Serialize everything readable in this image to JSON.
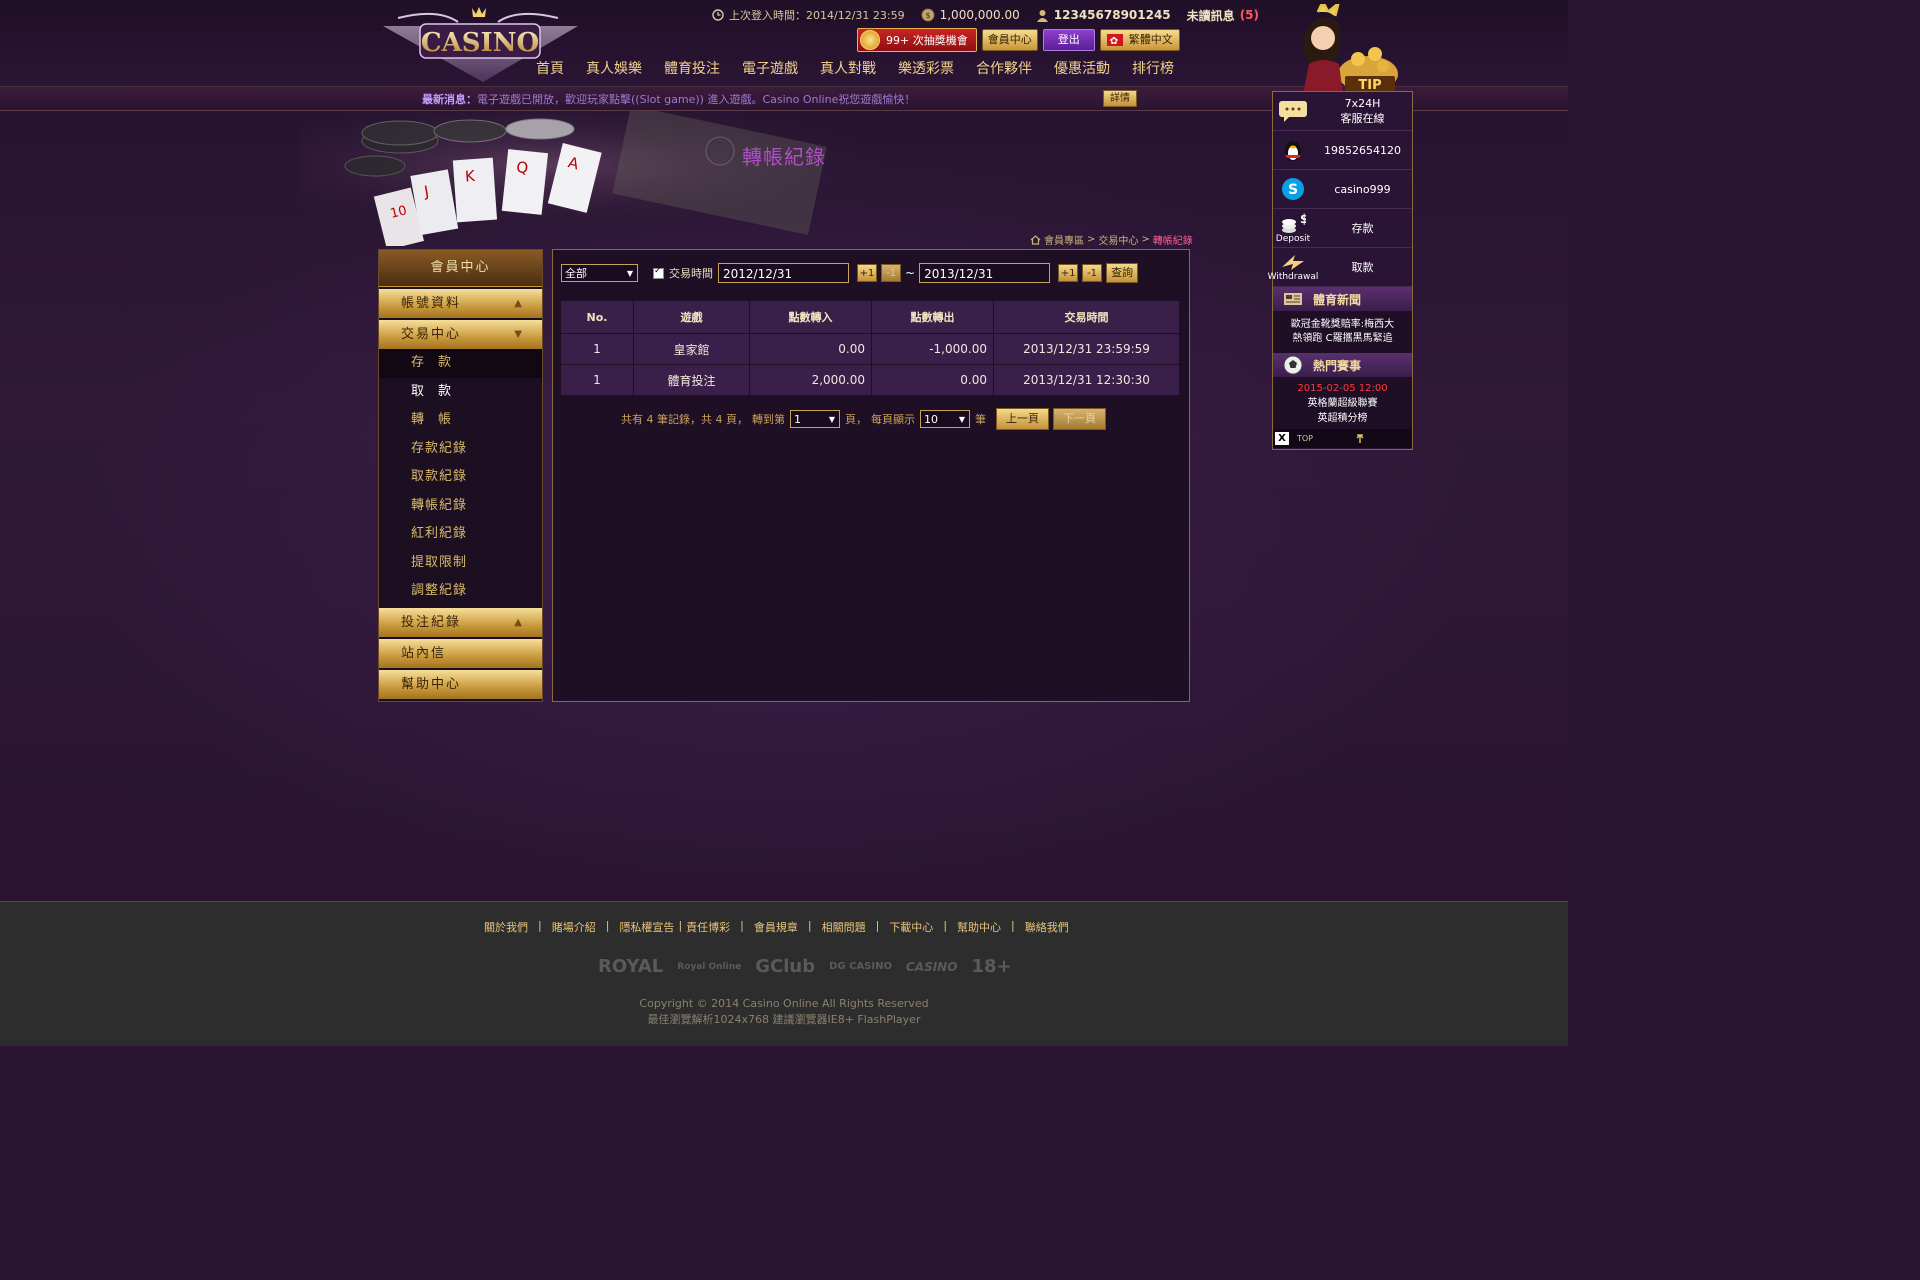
{
  "header": {
    "logo_text": "CASINO",
    "last_login_label": "上次登入時間：2014/12/31 23:59",
    "balance": "1,000,000.00",
    "username": "12345678901245",
    "unread_label": "未讀訊息",
    "unread_count": "(5)",
    "lottery_label": "99+ 次抽獎機會",
    "member_center_btn": "會員中心",
    "logout_btn": "登出",
    "language_btn": "繁體中文"
  },
  "nav": [
    "首頁",
    "真人娛樂",
    "體育投注",
    "電子遊戲",
    "真人對戰",
    "樂透彩票",
    "合作夥伴",
    "優惠活動",
    "排行榜"
  ],
  "news": {
    "label": "最新消息：",
    "text": "電子遊戲已開放，歡迎玩家點擊((Slot game)) 進入遊戲。Casino Online祝您遊戲愉快！",
    "detail_btn": "詳情"
  },
  "banner": {
    "title": "轉帳紀錄",
    "breadcrumb": [
      "會員專區",
      "交易中心",
      "轉帳紀錄"
    ],
    "breadcrumb_sep": ">"
  },
  "sidebar": {
    "header": "會員中心",
    "groups": [
      {
        "label": "帳號資料",
        "arrow": "▲"
      },
      {
        "label": "交易中心",
        "arrow": "▼"
      },
      {
        "label": "投注紀錄",
        "arrow": "▲"
      },
      {
        "label": "站內信",
        "arrow": ""
      },
      {
        "label": "幫助中心",
        "arrow": ""
      }
    ],
    "sub_items": [
      "存款",
      "取款",
      "轉帳",
      "存款紀錄",
      "取款紀錄",
      "轉帳紀錄",
      "紅利紀錄",
      "提取限制",
      "調整紀錄"
    ]
  },
  "filter": {
    "type_value": "全部",
    "time_label": "交易時間",
    "start_date": "2012/12/31",
    "end_date": "2013/12/31",
    "plus_label": "+1",
    "minus_label": "-1",
    "tilde": "~",
    "query_btn": "查詢"
  },
  "table": {
    "headers": [
      "No.",
      "遊戲",
      "點數轉入",
      "點數轉出",
      "交易時間"
    ],
    "rows": [
      {
        "no": "1",
        "game": "皇家館",
        "in": "0.00",
        "out": "-1,000.00",
        "time": "2013/12/31 23:59:59"
      },
      {
        "no": "1",
        "game": "體育投注",
        "in": "2,000.00",
        "out": "0.00",
        "time": "2013/12/31 12:30:30"
      }
    ]
  },
  "pager": {
    "summary": "共有 4 筆記錄，共 4 頁，",
    "goto_label": "轉到第",
    "page_value": "1",
    "page_unit": "頁，",
    "per_page_label": "每頁顯示",
    "per_page_value": "10",
    "per_page_unit": "筆",
    "prev_btn": "上一頁",
    "next_btn": "下一頁"
  },
  "widget": {
    "service_line1": "7x24H",
    "service_line2": "客服在線",
    "qq": "19852654120",
    "skype": "casino999",
    "deposit_icon_label": "Deposit",
    "deposit": "存款",
    "withdraw_icon_label": "Withdrawal",
    "withdraw": "取款",
    "sports_news_title": "體育新聞",
    "sports_news_line1": "歐冠金靴獎賠率:梅西大",
    "sports_news_line2": "熱領跑 C羅攜黑馬緊追",
    "hot_events_title": "熱門賽事",
    "event_date": "2015-02-05 12:00",
    "event_line1": "英格蘭超級聯賽",
    "event_line2": "英超積分榜",
    "top_label": "TOP",
    "tip_label": "TIP",
    "close_label": "X"
  },
  "footer": {
    "links": [
      "關於我們",
      "賭場介紹",
      "隱私權宣告",
      "責任博彩",
      "會員規章",
      "相關問題",
      "下載中心",
      "幫助中心",
      "聯絡我們"
    ],
    "partners": [
      "ROYAL",
      "Royal Online",
      "GClub",
      "DG CASINO",
      "CASINO",
      "18+"
    ],
    "copyright": "Copyright © 2014 Casino Online All Rights Reserved",
    "browser_note": "最佳瀏覽解析1024x768 建議瀏覽器IE8+ FlashPlayer"
  },
  "colors": {
    "gold": "#c9a15a",
    "purple_bg": "#2a1633",
    "green_in": "#36d93d",
    "red_out": "#e33d4d",
    "title_purple": "#b04ec9"
  }
}
